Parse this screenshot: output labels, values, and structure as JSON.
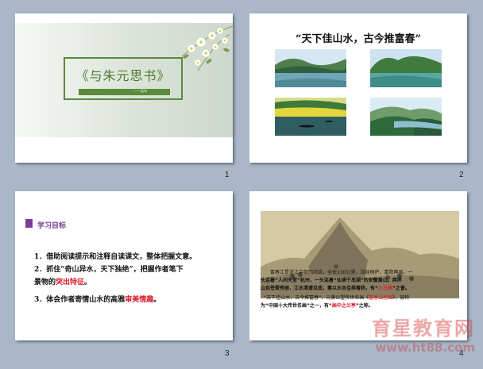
{
  "slides": [
    {
      "number": "1",
      "title": "《与朱元思书》",
      "author": "——吴均"
    },
    {
      "number": "2",
      "heading": "“天下佳山水，古今推富春”"
    },
    {
      "number": "3",
      "heading": "学习目标",
      "goals": [
        {
          "prefix": "1．",
          "text": "借助阅读提示和注释自读课文，整体把握文意。",
          "highlight": "",
          "suffix": ""
        },
        {
          "prefix": "2．",
          "text": "抓住“奇山异水，天下独绝”，把握作者笔下",
          "highlight": "",
          "suffix": ""
        },
        {
          "prefix": "",
          "text": "景物的",
          "highlight": "突出特征",
          "suffix": "。"
        },
        {
          "prefix": "3．",
          "text": "体会作者寄情山水的高雅",
          "highlight": "审美情趣",
          "suffix": "。"
        }
      ]
    },
    {
      "number": "4",
      "paragraph_lines": [
        {
          "a": "富春江是浙江中部的河流，全长110公里，流经桐庐、富阳两县。一",
          "b": "",
          "c": ""
        },
        {
          "a": "头连着“人间天堂”杭州，一头连着“仙境千岛湖”的安徽黄山。两岸",
          "b": "",
          "c": ""
        },
        {
          "a": "山色苍翠秀丽，江水清澈见底，素以水色佳美著称，有“",
          "b": "小三峡",
          "c": "”之誉。"
        },
        {
          "a": "“天下佳山水，古今推富春”，元黄公望传世名画《",
          "b": "富春山居图",
          "c": "》，被称"
        },
        {
          "a": "为“中国十大传世名画”之一，有“",
          "b": "画中之兰亭",
          "c": "”之称。"
        }
      ]
    }
  ],
  "watermark": {
    "brand": "育星教育网",
    "url": "www.ht88.com"
  },
  "colors": {
    "green": "#5b8a3a",
    "purple": "#7a3c96",
    "red": "#e0192b",
    "background": "#a9b7c8"
  }
}
